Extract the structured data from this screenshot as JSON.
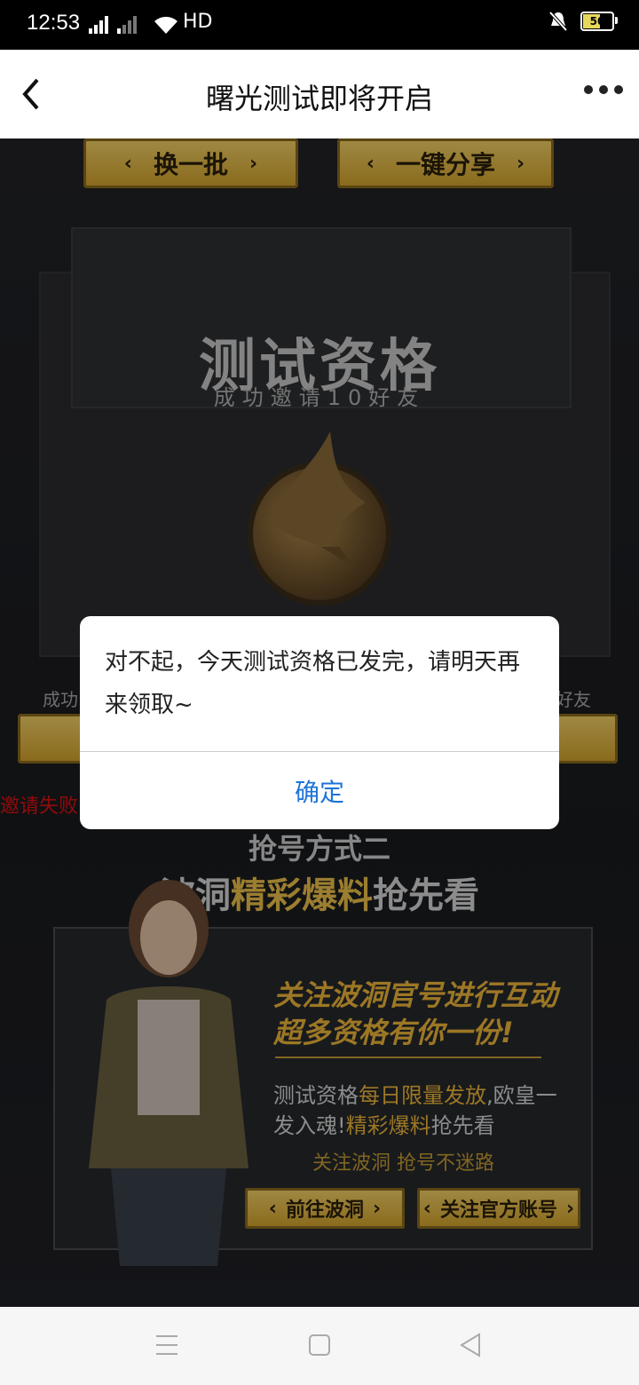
{
  "status_bar": {
    "time": "12:53",
    "network": "HD",
    "battery": "50"
  },
  "nav": {
    "title": "曙光测试即将开启"
  },
  "page": {
    "buttons": {
      "refresh": "换一批",
      "share": "一键分享"
    },
    "envelope": {
      "title": "测试资格",
      "subtitle": "成功邀请10好友"
    },
    "side_left": "成功",
    "side_right": "好友",
    "invite_fail": "邀请失败",
    "method_title": "抢号方式二",
    "method_sub_pre": "波洞",
    "method_sub_highlight": "精彩爆料",
    "method_sub_post": "抢先看",
    "panel": {
      "heading1": "关注波洞官号进行互动",
      "heading2": "超多资格有你一份!",
      "para1_a": "测试资格",
      "para1_hl": "每日限量发放",
      "para1_b": ",欧皇一",
      "para2_a": "发入魂!",
      "para2_hl": "精彩爆料",
      "para2_b": "抢先看",
      "tag": "关注波洞 抢号不迷路",
      "btn_go": "前往波洞",
      "btn_follow": "关注官方账号"
    }
  },
  "dialog": {
    "message": "对不起，今天测试资格已发完，请明天再来领取~",
    "ok": "确定"
  },
  "colors": {
    "accent_gold": "#f0b73a",
    "dialog_button": "#1e74d7",
    "error_red": "#dd1111"
  }
}
